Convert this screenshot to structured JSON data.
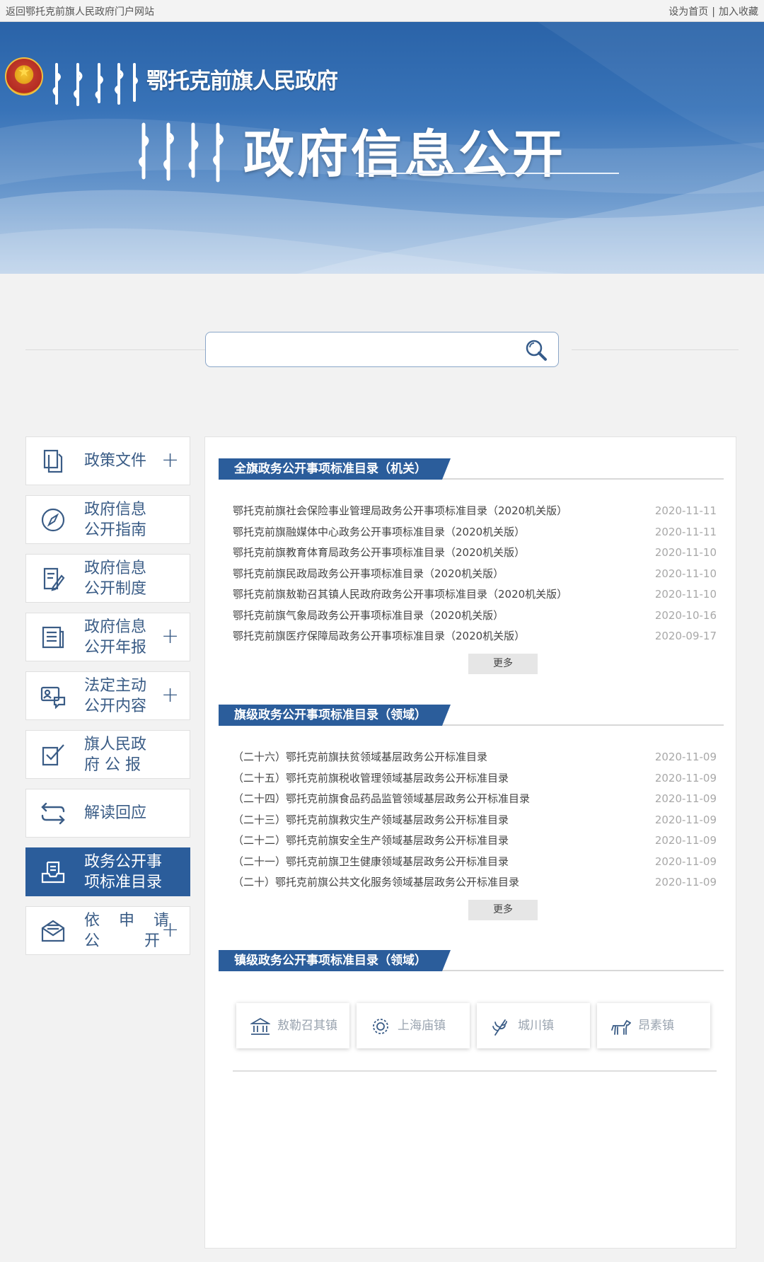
{
  "topbar": {
    "back_link": "返回鄂托克前旗人民政府门户网站",
    "set_home": "设为首页",
    "separator": "|",
    "add_favorite": "加入收藏"
  },
  "banner": {
    "site_name": "鄂托克前旗人民政府",
    "main_title": "政府信息公开",
    "emblem_icon": "national-emblem-icon"
  },
  "search": {
    "value": "",
    "placeholder": "",
    "icon": "search-icon"
  },
  "sidebar": {
    "items": [
      {
        "line1": "政策文件",
        "line2": "",
        "icon": "document-copy-icon",
        "plus": "+",
        "active": false
      },
      {
        "line1": "政府信息",
        "line2": "公开指南",
        "icon": "compass-icon",
        "plus": "",
        "active": false
      },
      {
        "line1": "政府信息",
        "line2": "公开制度",
        "icon": "edit-document-icon",
        "plus": "",
        "active": false
      },
      {
        "line1": "政府信息",
        "line2": "公开年报",
        "icon": "newspaper-icon",
        "plus": "+",
        "active": false
      },
      {
        "line1": "法定主动",
        "line2": "公开内容",
        "icon": "id-card-chat-icon",
        "plus": "+",
        "active": false
      },
      {
        "line1": "旗人民政",
        "line2": "府 公 报",
        "icon": "checked-document-icon",
        "plus": "",
        "active": false
      },
      {
        "line1": "解读回应",
        "line2": "",
        "icon": "exchange-arrows-icon",
        "plus": "",
        "active": false
      },
      {
        "line1": "政务公开事",
        "line2": "项标准目录",
        "icon": "file-tray-icon",
        "plus": "",
        "active": true
      },
      {
        "line1": "依 申 请",
        "line2": "公 开",
        "icon": "envelope-icon",
        "plus": "+",
        "active": false
      }
    ]
  },
  "sections": [
    {
      "title": "全旗政务公开事项标准目录（机关）",
      "rows": [
        {
          "title": "鄂托克前旗社会保险事业管理局政务公开事项标准目录（2020机关版）",
          "date": "2020-11-11"
        },
        {
          "title": "鄂托克前旗融媒体中心政务公开事项标准目录（2020机关版）",
          "date": "2020-11-11"
        },
        {
          "title": "鄂托克前旗教育体育局政务公开事项标准目录（2020机关版）",
          "date": "2020-11-10"
        },
        {
          "title": "鄂托克前旗民政局政务公开事项标准目录（2020机关版）",
          "date": "2020-11-10"
        },
        {
          "title": "鄂托克前旗敖勒召其镇人民政府政务公开事项标准目录（2020机关版）",
          "date": "2020-11-10"
        },
        {
          "title": "鄂托克前旗气象局政务公开事项标准目录（2020机关版）",
          "date": "2020-10-16"
        },
        {
          "title": "鄂托克前旗医疗保障局政务公开事项标准目录（2020机关版）",
          "date": "2020-09-17"
        }
      ],
      "more": "更多"
    },
    {
      "title": "旗级政务公开事项标准目录（领域）",
      "rows": [
        {
          "title": "（二十六）鄂托克前旗扶贫领域基层政务公开标准目录",
          "date": "2020-11-09"
        },
        {
          "title": "（二十五）鄂托克前旗税收管理领域基层政务公开标准目录",
          "date": "2020-11-09"
        },
        {
          "title": "（二十四）鄂托克前旗食品药品监管领域基层政务公开标准目录",
          "date": "2020-11-09"
        },
        {
          "title": "（二十三）鄂托克前旗救灾生产领域基层政务公开标准目录",
          "date": "2020-11-09"
        },
        {
          "title": "（二十二）鄂托克前旗安全生产领域基层政务公开标准目录",
          "date": "2020-11-09"
        },
        {
          "title": "（二十一）鄂托克前旗卫生健康领域基层政务公开标准目录",
          "date": "2020-11-09"
        },
        {
          "title": "（二十）鄂托克前旗公共文化服务领域基层政务公开标准目录",
          "date": "2020-11-09"
        }
      ],
      "more": "更多"
    },
    {
      "title": "镇级政务公开事项标准目录（领域）",
      "towns": [
        {
          "name": "敖勒召其镇",
          "icon": "government-building-icon"
        },
        {
          "name": "上海庙镇",
          "icon": "gear-flower-icon"
        },
        {
          "name": "城川镇",
          "icon": "wheat-icon"
        },
        {
          "name": "昂素镇",
          "icon": "horse-icon"
        }
      ]
    }
  ],
  "colors": {
    "primary": "#2b5d9b",
    "banner_top": "#2a63a8",
    "date_gray": "#a8a8a8"
  }
}
